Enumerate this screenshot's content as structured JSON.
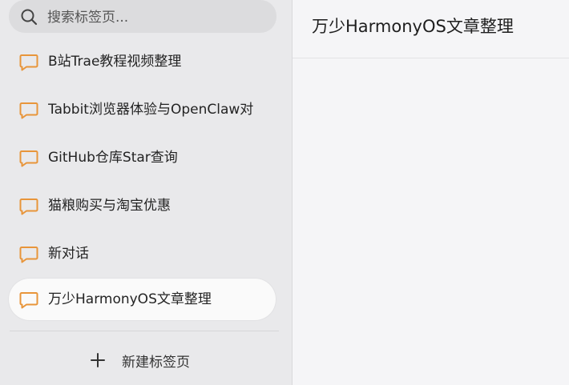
{
  "search": {
    "placeholder": "搜索标签页..."
  },
  "tabs": [
    {
      "label": "B站Trae教程视频整理",
      "active": false
    },
    {
      "label": "Tabbit浏览器体验与OpenClaw对",
      "active": false
    },
    {
      "label": "GitHub仓库Star查询",
      "active": false
    },
    {
      "label": "猫粮购买与淘宝优惠",
      "active": false
    },
    {
      "label": "新对话",
      "active": false
    },
    {
      "label": "万少HarmonyOS文章整理",
      "active": true
    }
  ],
  "new_tab": {
    "label": "新建标签页"
  },
  "main": {
    "title": "万少HarmonyOS文章整理"
  },
  "colors": {
    "accent": "#e8953a",
    "sidebar_bg": "#e9e9eb",
    "main_bg": "#f5f5f7"
  },
  "icons": {
    "search": "search-icon",
    "chat": "chat-bubble-icon",
    "plus": "plus-icon"
  }
}
